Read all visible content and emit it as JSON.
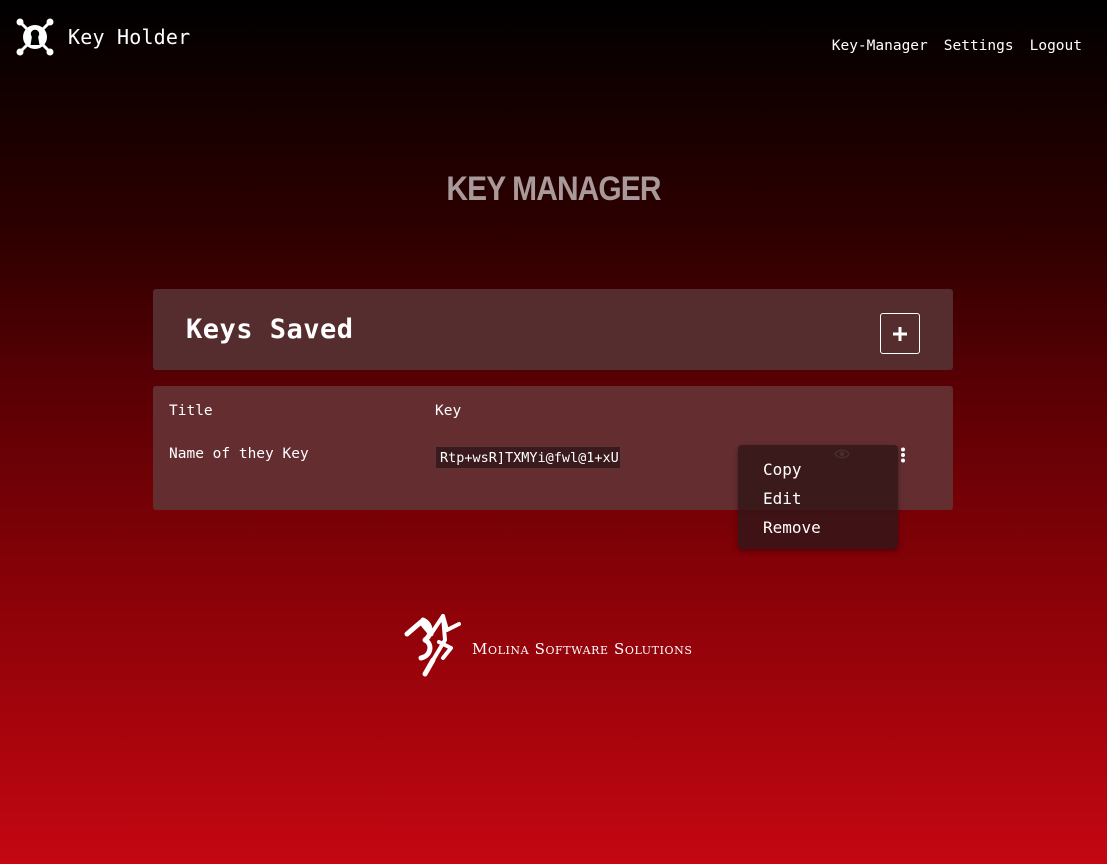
{
  "app": {
    "name": "Key Holder"
  },
  "nav": {
    "items": [
      "Key-Manager",
      "Settings",
      "Logout"
    ]
  },
  "page": {
    "title": "KEY MANAGER"
  },
  "keys_panel": {
    "title": "Keys Saved",
    "add_icon": "plus-icon"
  },
  "table": {
    "columns": [
      "Title",
      "Key"
    ],
    "rows": [
      {
        "title": "Name of they Key",
        "key": "Rtp+wsR]TXMYi@fwl@1+xU"
      }
    ]
  },
  "context_menu": {
    "items": [
      "Copy",
      "Edit",
      "Remove"
    ]
  },
  "icons": {
    "reveal": "eye-icon",
    "more": "more-vertical-icon",
    "brand": "keyhole-logo-icon"
  },
  "footer": {
    "company": "Molina Software Solutions"
  },
  "colors": {
    "panel_header": "#552d2f",
    "panel_table": "#642e31",
    "title_text": "#a9999a",
    "gradient_top": "#000000",
    "gradient_bottom": "#c40712"
  }
}
